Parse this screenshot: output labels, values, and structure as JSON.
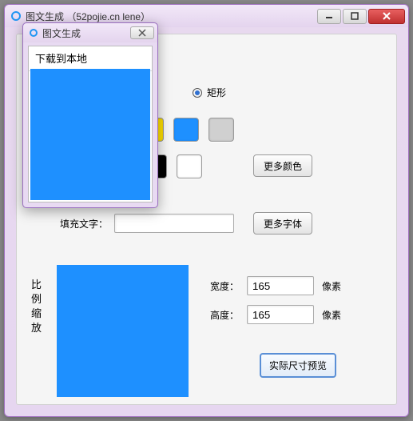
{
  "window": {
    "title": "图文生成 （52pojie.cn lene）"
  },
  "popup": {
    "title": "图文生成",
    "header": "下载到本地"
  },
  "shape": {
    "selected_label": "矩形"
  },
  "colors": {
    "row1": [
      "red",
      "yellow",
      "blue",
      "grey"
    ],
    "row2": [
      "black",
      "white"
    ],
    "more_colors_label": "更多颜色"
  },
  "text_fill": {
    "label": "填充文字：",
    "value": "",
    "more_fonts_label": "更多字体"
  },
  "scale": {
    "vlabel": "比例缩放",
    "width_label": "宽度：",
    "width_value": "165",
    "height_label": "高度：",
    "height_value": "165",
    "unit": "像素",
    "preview_btn": "实际尺寸预览"
  }
}
